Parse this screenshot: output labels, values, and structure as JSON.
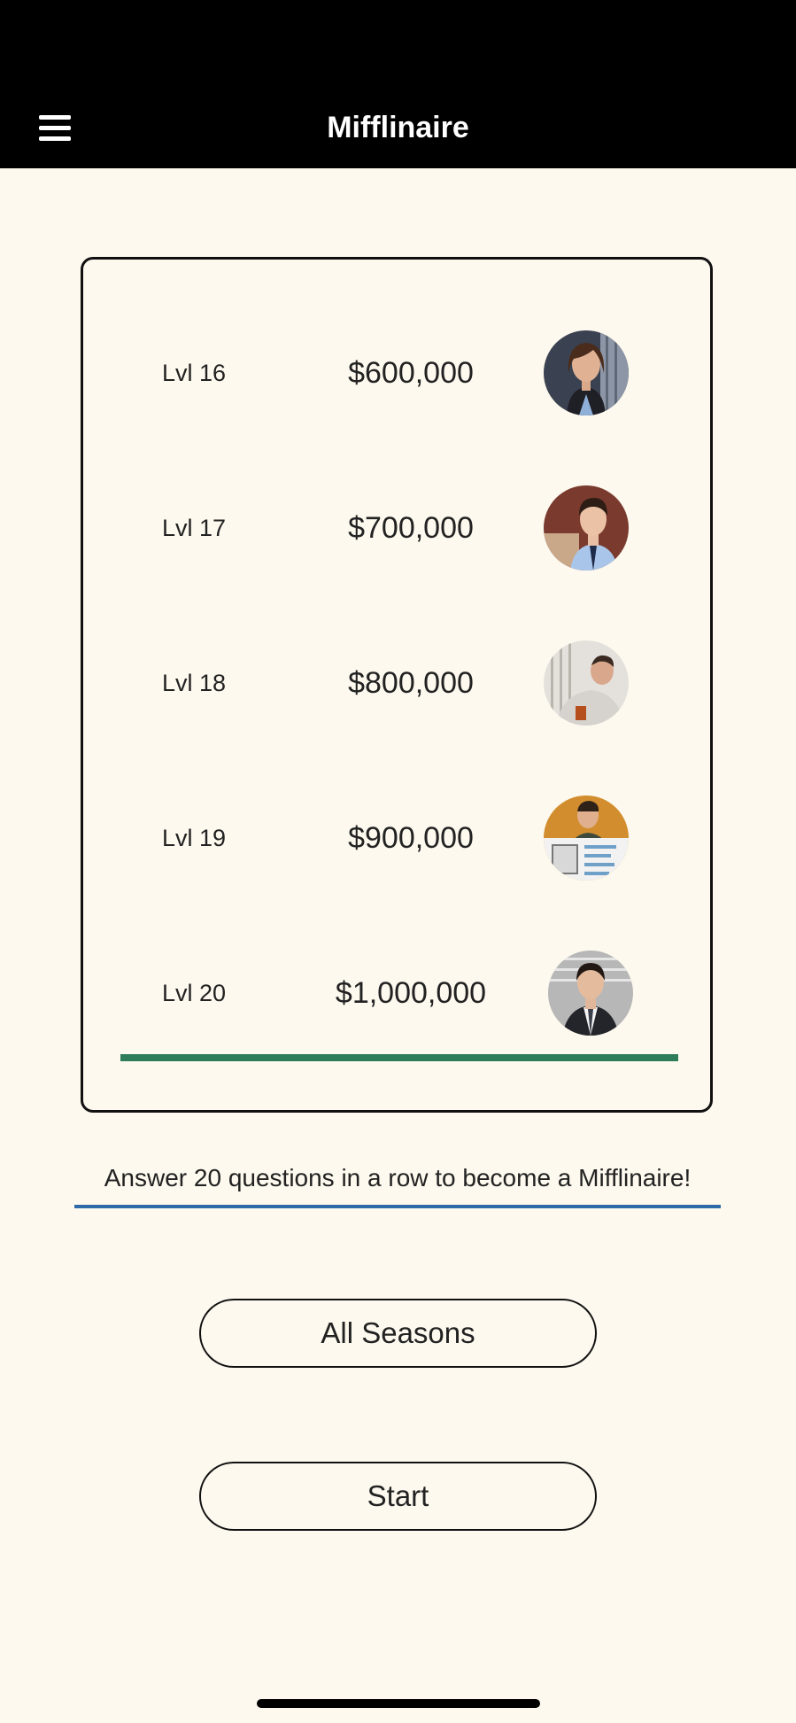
{
  "header": {
    "title": "Mifflinaire",
    "menu_icon": "hamburger-menu-icon"
  },
  "levels": [
    {
      "label": "Lvl 16",
      "amount": "$600,000",
      "avatar": "character-portrait-1"
    },
    {
      "label": "Lvl 17",
      "amount": "$700,000",
      "avatar": "character-portrait-2"
    },
    {
      "label": "Lvl 18",
      "amount": "$800,000",
      "avatar": "character-portrait-3"
    },
    {
      "label": "Lvl 19",
      "amount": "$900,000",
      "avatar": "character-portrait-4"
    },
    {
      "label": "Lvl 20",
      "amount": "$1,000,000",
      "avatar": "character-portrait-5"
    }
  ],
  "tagline": "Answer 20 questions in a row to become a Mifflinaire!",
  "buttons": {
    "season": "All Seasons",
    "start": "Start"
  },
  "colors": {
    "header_bg": "#000000",
    "page_bg": "#fdf9ee",
    "progress_accent": "#2e7d5a",
    "tagline_underline": "#2f6aa8"
  }
}
